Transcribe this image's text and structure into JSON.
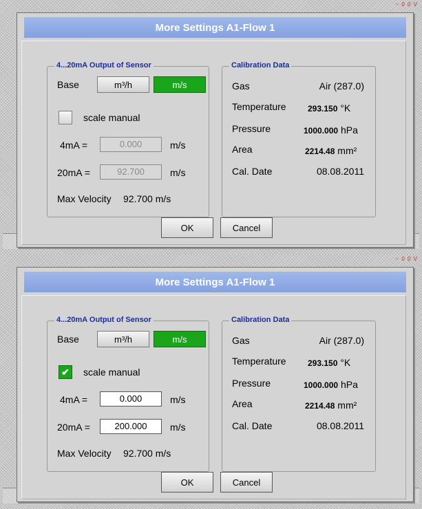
{
  "dialog_title": "More Settings A1-Flow 1",
  "frame_tag": "~ 0 0 V",
  "sensor_group": {
    "legend": "4...20mA Output of Sensor",
    "base_label": "Base",
    "unit_m3h": "m³/h",
    "unit_ms": "m/s",
    "scale_manual_label": "scale manual",
    "label_4ma": "4mA =",
    "label_20ma": "20mA =",
    "field_unit": "m/s",
    "max_velocity_label": "Max Velocity",
    "max_velocity_value": "92.700 m/s"
  },
  "calibration": {
    "legend": "Calibration Data",
    "gas_label": "Gas",
    "gas_value": "Air (287.0)",
    "temp_label": "Temperature",
    "temp_value": "293.150",
    "temp_unit": "°K",
    "pressure_label": "Pressure",
    "pressure_value": "1000.000",
    "pressure_unit": "hPa",
    "area_label": "Area",
    "area_value": "2214.48",
    "area_unit": "mm²",
    "date_label": "Cal. Date",
    "date_value": "08.08.2011"
  },
  "buttons": {
    "ok": "OK",
    "cancel": "Cancel"
  },
  "top": {
    "scale_manual_checked": false,
    "check_mark": "",
    "value_4ma": "0.000",
    "value_20ma": "92.700"
  },
  "bottom": {
    "scale_manual_checked": true,
    "check_mark": "✔",
    "value_4ma": "0.000",
    "value_20ma": "200.000"
  },
  "colors": {
    "active_green": "#1aa51a",
    "title_blue": "#8fabe6",
    "legend_blue": "#1a2d9c"
  }
}
